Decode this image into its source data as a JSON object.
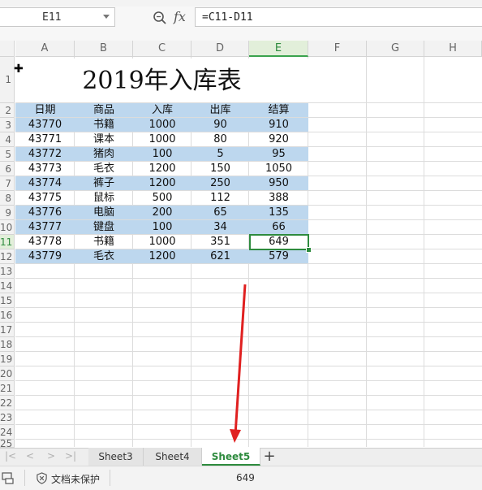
{
  "formula_bar": {
    "cell_ref": "E11",
    "formula": "=C11-D11",
    "fx_label": "fx"
  },
  "columns": [
    "A",
    "B",
    "C",
    "D",
    "E",
    "F",
    "G",
    "H"
  ],
  "selected_column": "E",
  "rows": [
    "1",
    "2",
    "3",
    "4",
    "5",
    "6",
    "7",
    "8",
    "9",
    "10",
    "11",
    "12",
    "13",
    "14",
    "15",
    "16",
    "17",
    "18",
    "19",
    "20",
    "21",
    "22",
    "23",
    "24",
    "25"
  ],
  "selected_row": "11",
  "table": {
    "title": "2019年入库表",
    "headers": [
      "日期",
      "商品",
      "入库",
      "出库",
      "结算"
    ],
    "rows": [
      [
        "43770",
        "书籍",
        "1000",
        "90",
        "910"
      ],
      [
        "43771",
        "课本",
        "1000",
        "80",
        "920"
      ],
      [
        "43772",
        "猪肉",
        "100",
        "5",
        "95"
      ],
      [
        "43773",
        "毛衣",
        "1200",
        "150",
        "1050"
      ],
      [
        "43774",
        "裤子",
        "1200",
        "250",
        "950"
      ],
      [
        "43775",
        "鼠标",
        "500",
        "112",
        "388"
      ],
      [
        "43776",
        "电脑",
        "200",
        "65",
        "135"
      ],
      [
        "43777",
        "键盘",
        "100",
        "34",
        "66"
      ],
      [
        "43778",
        "书籍",
        "1000",
        "351",
        "649"
      ],
      [
        "43779",
        "毛衣",
        "1200",
        "621",
        "579"
      ]
    ]
  },
  "sheet_tabs": [
    "Sheet3",
    "Sheet4",
    "Sheet5"
  ],
  "active_sheet": "Sheet5",
  "add_sheet_label": "+",
  "nav_buttons": [
    "|<",
    "<",
    ">",
    ">|"
  ],
  "status_bar": {
    "protection_label": "文档未保护",
    "selection_value": "649"
  },
  "colors": {
    "band": "#bdd7ee",
    "selection": "#2e8b3e",
    "annotation_arrow": "#e02020"
  }
}
